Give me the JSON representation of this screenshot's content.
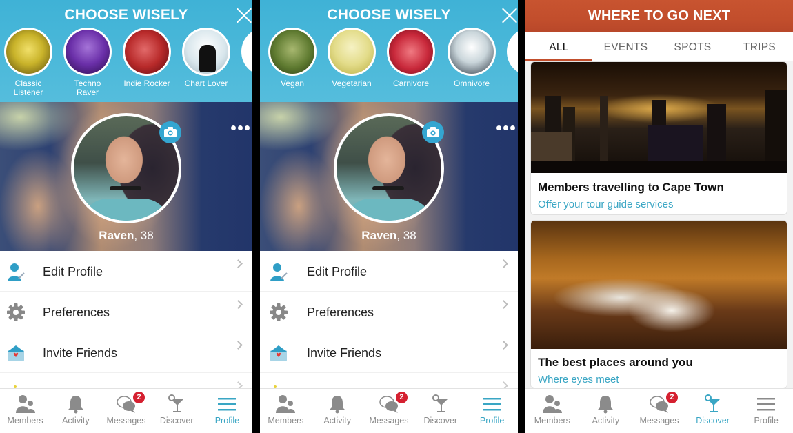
{
  "panels": [
    {
      "chooser": {
        "title": "CHOOSE WISELY",
        "options": [
          {
            "label": "Classic Listener",
            "label_lines": [
              "Classic",
              "Listener"
            ],
            "avatar": "beethoven-portrait"
          },
          {
            "label": "Techno Raver",
            "label_lines": [
              "Techno Raver"
            ],
            "avatar": "dj-portrait"
          },
          {
            "label": "Indie Rocker",
            "label_lines": [
              "Indie Rocker"
            ],
            "avatar": "band-portrait"
          },
          {
            "label": "Chart Lover",
            "label_lines": [
              "Chart Lover"
            ],
            "avatar": "pop-singer-portrait"
          }
        ]
      },
      "profile": {
        "name": "Raven",
        "age_suffix": ", 38"
      },
      "menu": [
        {
          "label": "Edit Profile",
          "icon": "edit-profile-icon"
        },
        {
          "label": "Preferences",
          "icon": "gear-icon"
        },
        {
          "label": "Invite Friends",
          "icon": "invite-envelope-icon"
        }
      ],
      "tabs": [
        {
          "label": "Members",
          "icon": "members-icon",
          "active": false
        },
        {
          "label": "Activity",
          "icon": "bell-icon",
          "active": false
        },
        {
          "label": "Messages",
          "icon": "chat-bubbles-icon",
          "active": false,
          "badge": "2"
        },
        {
          "label": "Discover",
          "icon": "cocktail-icon",
          "active": false
        },
        {
          "label": "Profile",
          "icon": "hamburger-menu-icon",
          "active": true
        }
      ]
    },
    {
      "chooser": {
        "title": "CHOOSE WISELY",
        "options": [
          {
            "label": "Vegan",
            "label_lines": [
              "Vegan"
            ],
            "avatar": "chipmunk-photo"
          },
          {
            "label": "Vegetarian",
            "label_lines": [
              "Vegetarian"
            ],
            "avatar": "antelope-photo"
          },
          {
            "label": "Carnivore",
            "label_lines": [
              "Carnivore"
            ],
            "avatar": "tiger-photo"
          },
          {
            "label": "Omnivore",
            "label_lines": [
              "Omnivore"
            ],
            "avatar": "panda-photo"
          }
        ]
      },
      "profile": {
        "name": "Raven",
        "age_suffix": ", 38"
      },
      "menu": [
        {
          "label": "Edit Profile",
          "icon": "edit-profile-icon"
        },
        {
          "label": "Preferences",
          "icon": "gear-icon"
        },
        {
          "label": "Invite Friends",
          "icon": "invite-envelope-icon"
        }
      ],
      "tabs": [
        {
          "label": "Members",
          "icon": "members-icon",
          "active": false
        },
        {
          "label": "Activity",
          "icon": "bell-icon",
          "active": false
        },
        {
          "label": "Messages",
          "icon": "chat-bubbles-icon",
          "active": false,
          "badge": "2"
        },
        {
          "label": "Discover",
          "icon": "cocktail-icon",
          "active": false
        },
        {
          "label": "Profile",
          "icon": "hamburger-menu-icon",
          "active": true
        }
      ]
    },
    {
      "header": {
        "title": "WHERE TO GO NEXT"
      },
      "filter_tabs": [
        {
          "label": "ALL",
          "active": true
        },
        {
          "label": "EVENTS",
          "active": false
        },
        {
          "label": "SPOTS",
          "active": false
        },
        {
          "label": "TRIPS",
          "active": false
        }
      ],
      "cards": [
        {
          "title": "Members travelling to Cape Town",
          "subtitle": "Offer your tour guide services",
          "image": "city-night-skyline"
        },
        {
          "title": "The best places around you",
          "subtitle": "Where eyes meet",
          "image": "restaurant-table"
        }
      ],
      "tabs": [
        {
          "label": "Members",
          "icon": "members-icon",
          "active": false
        },
        {
          "label": "Activity",
          "icon": "bell-icon",
          "active": false
        },
        {
          "label": "Messages",
          "icon": "chat-bubbles-icon",
          "active": false,
          "badge": "2"
        },
        {
          "label": "Discover",
          "icon": "cocktail-icon",
          "active": true
        },
        {
          "label": "Profile",
          "icon": "hamburger-menu-icon",
          "active": false
        }
      ]
    }
  ],
  "colors": {
    "teal_accent": "#3aa6c4",
    "chooser_bg": "#4cb9da",
    "discover_header": "#c24e2c",
    "badge_red": "#d52030",
    "inactive_gray": "#8b8b8b"
  }
}
